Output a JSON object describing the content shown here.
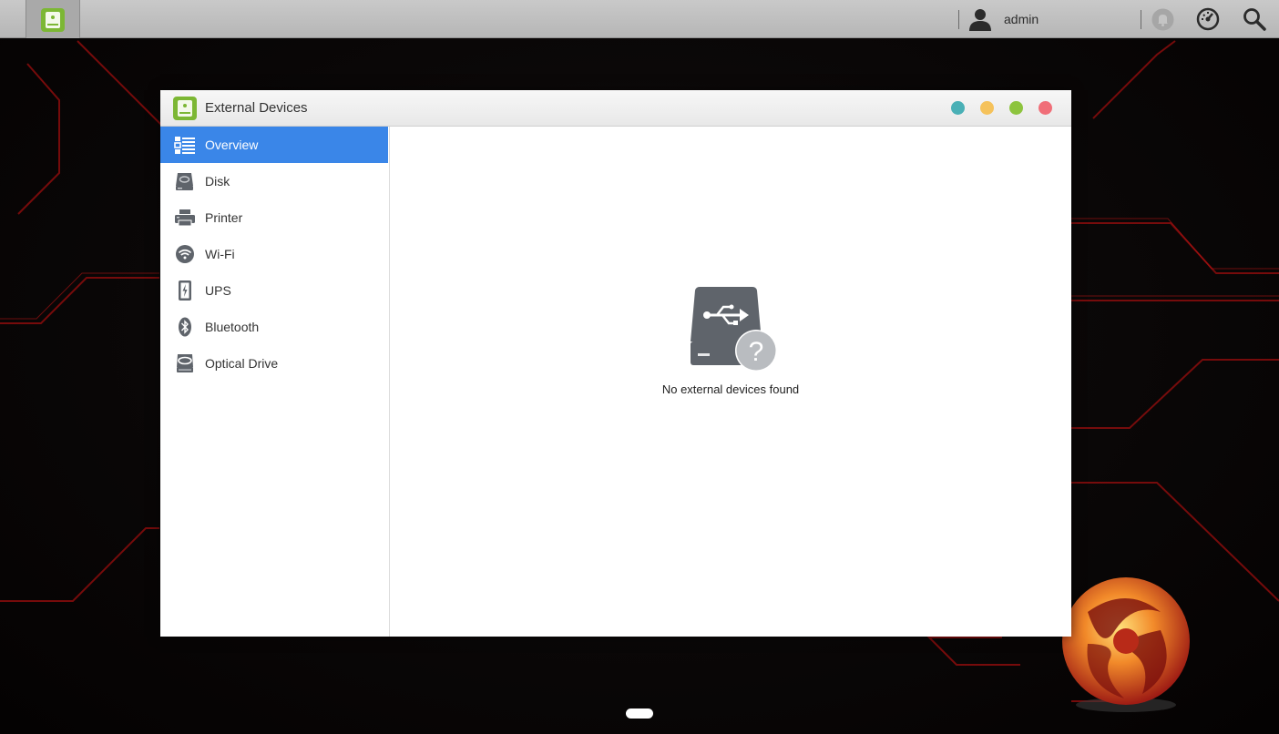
{
  "taskbar": {
    "app_icon": "external-devices-app-icon",
    "user": {
      "icon": "user-icon",
      "name": "admin"
    },
    "icons": [
      "notification-bell-icon",
      "dashboard-gauge-icon",
      "search-icon"
    ]
  },
  "window": {
    "title": "External Devices",
    "icon": "usb-drive-app-icon",
    "controls": [
      {
        "name": "minimize",
        "color": "#4ab0b6"
      },
      {
        "name": "maximize",
        "color": "#f5c25b"
      },
      {
        "name": "restore",
        "color": "#8dc43e"
      },
      {
        "name": "close",
        "color": "#f06e78"
      }
    ]
  },
  "sidebar": {
    "items": [
      {
        "label": "Overview",
        "icon": "overview-list-icon",
        "active": true
      },
      {
        "label": "Disk",
        "icon": "disk-icon",
        "active": false
      },
      {
        "label": "Printer",
        "icon": "printer-icon",
        "active": false
      },
      {
        "label": "Wi-Fi",
        "icon": "wifi-icon",
        "active": false
      },
      {
        "label": "UPS",
        "icon": "ups-battery-icon",
        "active": false
      },
      {
        "label": "Bluetooth",
        "icon": "bluetooth-icon",
        "active": false
      },
      {
        "label": "Optical Drive",
        "icon": "optical-drive-icon",
        "active": false
      }
    ]
  },
  "main": {
    "empty_state": {
      "icon": "usb-drive-question-icon",
      "message": "No external devices found"
    }
  },
  "colors": {
    "accent": "#3a86e8",
    "icon_gray": "#5f646b",
    "app_green": "#8dc43e"
  }
}
